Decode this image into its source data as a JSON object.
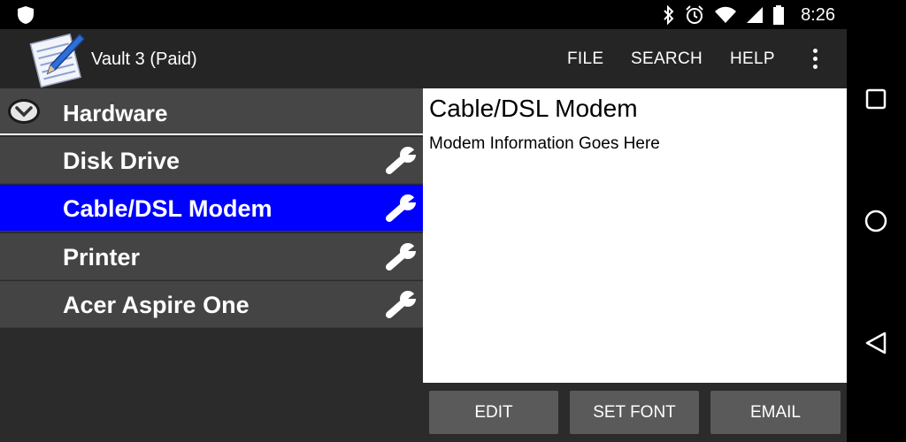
{
  "status_bar": {
    "time": "8:26",
    "icons": [
      "shield-icon",
      "bluetooth-icon",
      "alarm-icon",
      "wifi-icon",
      "signal-icon",
      "battery-icon"
    ]
  },
  "app_bar": {
    "title": "Vault 3 (Paid)",
    "icon": "notepad-pencil-icon",
    "menu": {
      "file": "FILE",
      "search": "SEARCH",
      "help": "HELP"
    },
    "overflow_icon": "overflow-menu-icon"
  },
  "tree": {
    "group": {
      "label": "Hardware",
      "icon": "collapse-chevron-icon"
    },
    "items": [
      {
        "label": "Disk Drive",
        "selected": false
      },
      {
        "label": "Cable/DSL Modem",
        "selected": true
      },
      {
        "label": "Printer",
        "selected": false
      },
      {
        "label": "Acer Aspire One",
        "selected": false
      }
    ],
    "item_icon": "wrench-icon"
  },
  "content": {
    "title": "Cable/DSL Modem",
    "body": "Modem Information Goes Here"
  },
  "actions": {
    "edit": "EDIT",
    "set_font": "SET FONT",
    "email": "EMAIL"
  },
  "nav_bar": {
    "icons": [
      "recents-icon",
      "home-icon",
      "back-icon"
    ]
  },
  "colors": {
    "selection": "#0000ff",
    "app_bar": "#252525",
    "row": "#444444",
    "button": "#5a5a5a"
  }
}
